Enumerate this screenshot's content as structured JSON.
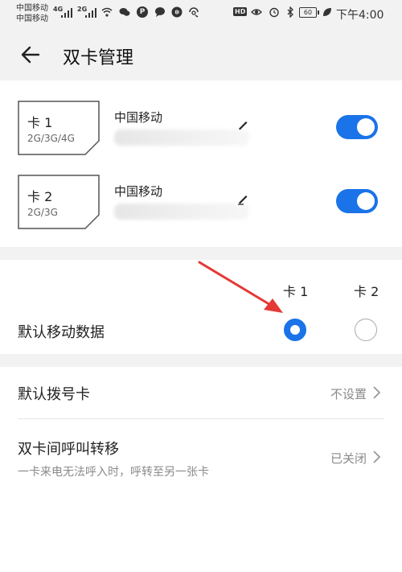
{
  "status_bar": {
    "carrier_1": "中国移动",
    "carrier_2": "中国移动",
    "net_1": "4G",
    "net_2": "2G",
    "hd": "HD",
    "battery": "60",
    "time": "下午4:00"
  },
  "header": {
    "title": "双卡管理"
  },
  "sim_cards": [
    {
      "name": "卡 1",
      "networks": "2G/3G/4G",
      "carrier": "中国移动",
      "enabled": true
    },
    {
      "name": "卡 2",
      "networks": "2G/3G",
      "carrier": "中国移动",
      "enabled": true
    }
  ],
  "default_data": {
    "label": "默认移动数据",
    "columns": [
      "卡 1",
      "卡 2"
    ],
    "selected": "卡 1"
  },
  "settings": [
    {
      "title": "默认拨号卡",
      "value": "不设置"
    },
    {
      "title": "双卡间呼叫转移",
      "subtitle": "一卡来电无法呼入时，呼转至另一张卡",
      "value": "已关闭"
    }
  ],
  "colors": {
    "accent": "#1a73e8",
    "annotation_arrow": "#e53935"
  }
}
